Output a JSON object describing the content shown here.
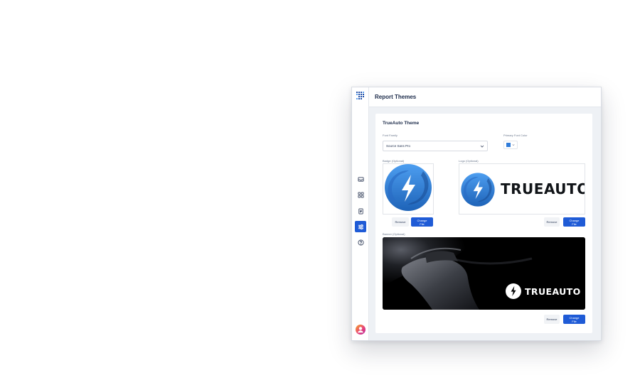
{
  "page": {
    "title": "Report Themes"
  },
  "theme": {
    "title": "TrueAuto Theme",
    "font_family_label": "Font Family",
    "font_family_value": "Source Sans Pro",
    "primary_font_color_label": "Primary Font Color",
    "primary_font_color": "#2f7bd9",
    "badge_label": "Badge (Optional)",
    "logo_label": "Logo (Optional)",
    "banner_label": "Banner (Optional)",
    "remove_label": "Remove",
    "change_file_label": "Change File"
  },
  "logo_brand": {
    "wordmark": "TRUEAUTO"
  },
  "banner_brand": {
    "wordmark": "TRUEAUTO"
  },
  "sidebar": {
    "items": [
      {
        "icon": "inbox-icon"
      },
      {
        "icon": "grid-icon"
      },
      {
        "icon": "document-icon"
      },
      {
        "icon": "sliders-icon",
        "active": true
      },
      {
        "icon": "help-icon"
      }
    ]
  },
  "colors": {
    "accent": "#1f5bd6",
    "brand_blue": "#2f7bd9"
  }
}
